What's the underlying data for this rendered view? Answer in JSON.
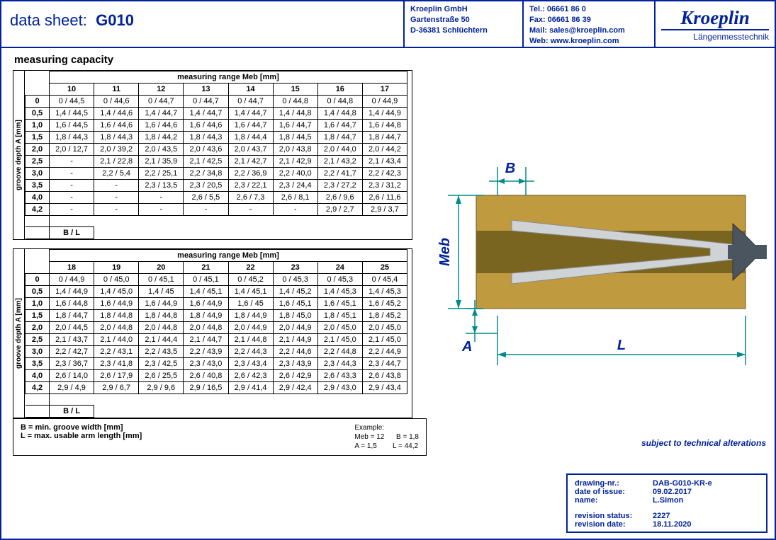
{
  "header": {
    "title_label": "data sheet:",
    "title_value": "G010",
    "addr": {
      "l1": "Kroeplin GmbH",
      "l2": "Gartenstraße 50",
      "l3": "D-36381 Schlüchtern"
    },
    "tel": {
      "l1": "Tel.:   06661 86 0",
      "l2": "Fax:  06661 86 39",
      "mail_lbl": "Mail:",
      "mail_val": "sales@kroeplin.com",
      "web_lbl": "Web:",
      "web_val": "www.kroeplin.com"
    },
    "logo": {
      "brand": "Kroeplin",
      "tagline": "Längenmesstechnik"
    }
  },
  "section_title": "measuring capacity",
  "rot_label": "groove depth A\n[mm]",
  "range_title": "measuring range Meb [mm]",
  "bl_label": "B / L",
  "table1": {
    "cols": [
      "10",
      "11",
      "12",
      "13",
      "14",
      "15",
      "16",
      "17"
    ],
    "rows": [
      {
        "h": "0",
        "c": [
          "0 / 44,5",
          "0 / 44,6",
          "0 / 44,7",
          "0 / 44,7",
          "0 / 44,7",
          "0 / 44,8",
          "0 / 44,8",
          "0 / 44,9"
        ]
      },
      {
        "h": "0,5",
        "c": [
          "1,4 / 44,5",
          "1,4 / 44,6",
          "1,4 / 44,7",
          "1,4 / 44,7",
          "1,4 / 44,7",
          "1,4 / 44,8",
          "1,4 / 44,8",
          "1,4 / 44,9"
        ]
      },
      {
        "h": "1,0",
        "c": [
          "1,6 / 44,5",
          "1,6 / 44,6",
          "1,6 / 44,6",
          "1,6 / 44,6",
          "1,6 / 44,7",
          "1,6 / 44,7",
          "1,6 / 44,7",
          "1,6 / 44,8"
        ]
      },
      {
        "h": "1,5",
        "c": [
          "1,8 / 44,3",
          "1,8 / 44,3",
          "1,8 / 44,2",
          "1,8 / 44,3",
          "1,8 / 44,4",
          "1,8 / 44,5",
          "1,8 / 44,7",
          "1,8 / 44,7"
        ]
      },
      {
        "h": "2,0",
        "c": [
          "2,0 / 12,7",
          "2,0 / 39,2",
          "2,0 / 43,5",
          "2,0 / 43,6",
          "2,0 / 43,7",
          "2,0 / 43,8",
          "2,0 / 44,0",
          "2,0 / 44,2"
        ]
      },
      {
        "h": "2,5",
        "c": [
          "-",
          "2,1 / 22,8",
          "2,1 / 35,9",
          "2,1 / 42,5",
          "2,1 / 42,7",
          "2,1 / 42,9",
          "2,1 / 43,2",
          "2,1 / 43,4"
        ]
      },
      {
        "h": "3,0",
        "c": [
          "-",
          "2,2 / 5,4",
          "2,2 / 25,1",
          "2,2 / 34,8",
          "2,2 / 36,9",
          "2,2 / 40,0",
          "2,2 / 41,7",
          "2,2 / 42,3"
        ]
      },
      {
        "h": "3,5",
        "c": [
          "-",
          "-",
          "2,3 / 13,5",
          "2,3 / 20,5",
          "2,3 / 22,1",
          "2,3 / 24,4",
          "2,3 / 27,2",
          "2,3 / 31,2"
        ]
      },
      {
        "h": "4,0",
        "c": [
          "-",
          "-",
          "-",
          "2,6 / 5,5",
          "2,6 / 7,3",
          "2,6 / 8,1",
          "2,6 / 9,6",
          "2,6 / 11,6"
        ]
      },
      {
        "h": "4,2",
        "c": [
          "-",
          "-",
          "-",
          "-",
          "-",
          "-",
          "2,9 / 2,7",
          "2,9 / 3,7"
        ]
      }
    ]
  },
  "table2": {
    "cols": [
      "18",
      "19",
      "20",
      "21",
      "22",
      "23",
      "24",
      "25"
    ],
    "rows": [
      {
        "h": "0",
        "c": [
          "0 / 44,9",
          "0 / 45,0",
          "0 / 45,1",
          "0 / 45,1",
          "0 / 45,2",
          "0 / 45,3",
          "0 / 45,3",
          "0 / 45,4"
        ]
      },
      {
        "h": "0,5",
        "c": [
          "1,4 / 44,9",
          "1,4 / 45,0",
          "1,4 / 45",
          "1,4 / 45,1",
          "1,4 / 45,1",
          "1,4 / 45,2",
          "1,4 / 45,3",
          "1,4 / 45,3"
        ]
      },
      {
        "h": "1,0",
        "c": [
          "1,6 / 44,8",
          "1,6 / 44,9",
          "1,6 / 44,9",
          "1,6 / 44,9",
          "1,6 / 45",
          "1,6 / 45,1",
          "1,6 / 45,1",
          "1,6 / 45,2"
        ]
      },
      {
        "h": "1,5",
        "c": [
          "1,8 / 44,7",
          "1,8 / 44,8",
          "1,8 / 44,8",
          "1,8 / 44,9",
          "1,8 / 44,9",
          "1,8 / 45,0",
          "1,8 / 45,1",
          "1,8 / 45,2"
        ]
      },
      {
        "h": "2,0",
        "c": [
          "2,0 / 44,5",
          "2,0 / 44,8",
          "2,0 / 44,8",
          "2,0 / 44,8",
          "2,0 / 44,9",
          "2,0 / 44,9",
          "2,0 / 45,0",
          "2,0 / 45,0"
        ]
      },
      {
        "h": "2,5",
        "c": [
          "2,1 / 43,7",
          "2,1 / 44,0",
          "2,1 / 44,4",
          "2,1 / 44,7",
          "2,1 / 44,8",
          "2,1 / 44,9",
          "2,1 / 45,0",
          "2,1 / 45,0"
        ]
      },
      {
        "h": "3,0",
        "c": [
          "2,2 / 42,7",
          "2,2 / 43,1",
          "2,2 / 43,5",
          "2,2 / 43,9",
          "2,2 / 44,3",
          "2,2 / 44,6",
          "2,2 / 44,8",
          "2,2 / 44,9"
        ]
      },
      {
        "h": "3,5",
        "c": [
          "2,3 / 36,7",
          "2,3 / 41,8",
          "2,3 / 42,5",
          "2,3 / 43,0",
          "2,3 / 43,4",
          "2,3 / 43,9",
          "2,3 / 44,3",
          "2,3 / 44,7"
        ]
      },
      {
        "h": "4,0",
        "c": [
          "2,6 / 14,0",
          "2,6 / 17,9",
          "2,6 / 25,5",
          "2,6 / 40,8",
          "2,6 / 42,3",
          "2,6 / 42,9",
          "2,6 / 43,3",
          "2,6 / 43,8"
        ]
      },
      {
        "h": "4,2",
        "c": [
          "2,9 / 4,9",
          "2,9 / 6,7",
          "2,9 / 9,6",
          "2,9 / 16,5",
          "2,9 / 41,4",
          "2,9 / 42,4",
          "2,9 / 43,0",
          "2,9 / 43,4"
        ]
      }
    ]
  },
  "legend": {
    "b": "B = min. groove width [mm]",
    "l": "L = max. usable arm length [mm]",
    "ex_title": "Example:",
    "ex_l1": "Meb = 12      B = 1,8",
    "ex_l2": "A = 1,5        L = 44,2"
  },
  "diagram": {
    "B": "B",
    "Meb": "Meb",
    "A": "A",
    "L": "L"
  },
  "alteration_note": "subject to technical alterations",
  "info": {
    "k1": "drawing-nr.:",
    "v1": "DAB-G010-KR-e",
    "k2": "date of issue:",
    "v2": "09.02.2017",
    "k3": "name:",
    "v3": "L.Simon",
    "k4": "revision status:",
    "v4": "2227",
    "k5": "revision date:",
    "v5": "18.11.2020"
  }
}
